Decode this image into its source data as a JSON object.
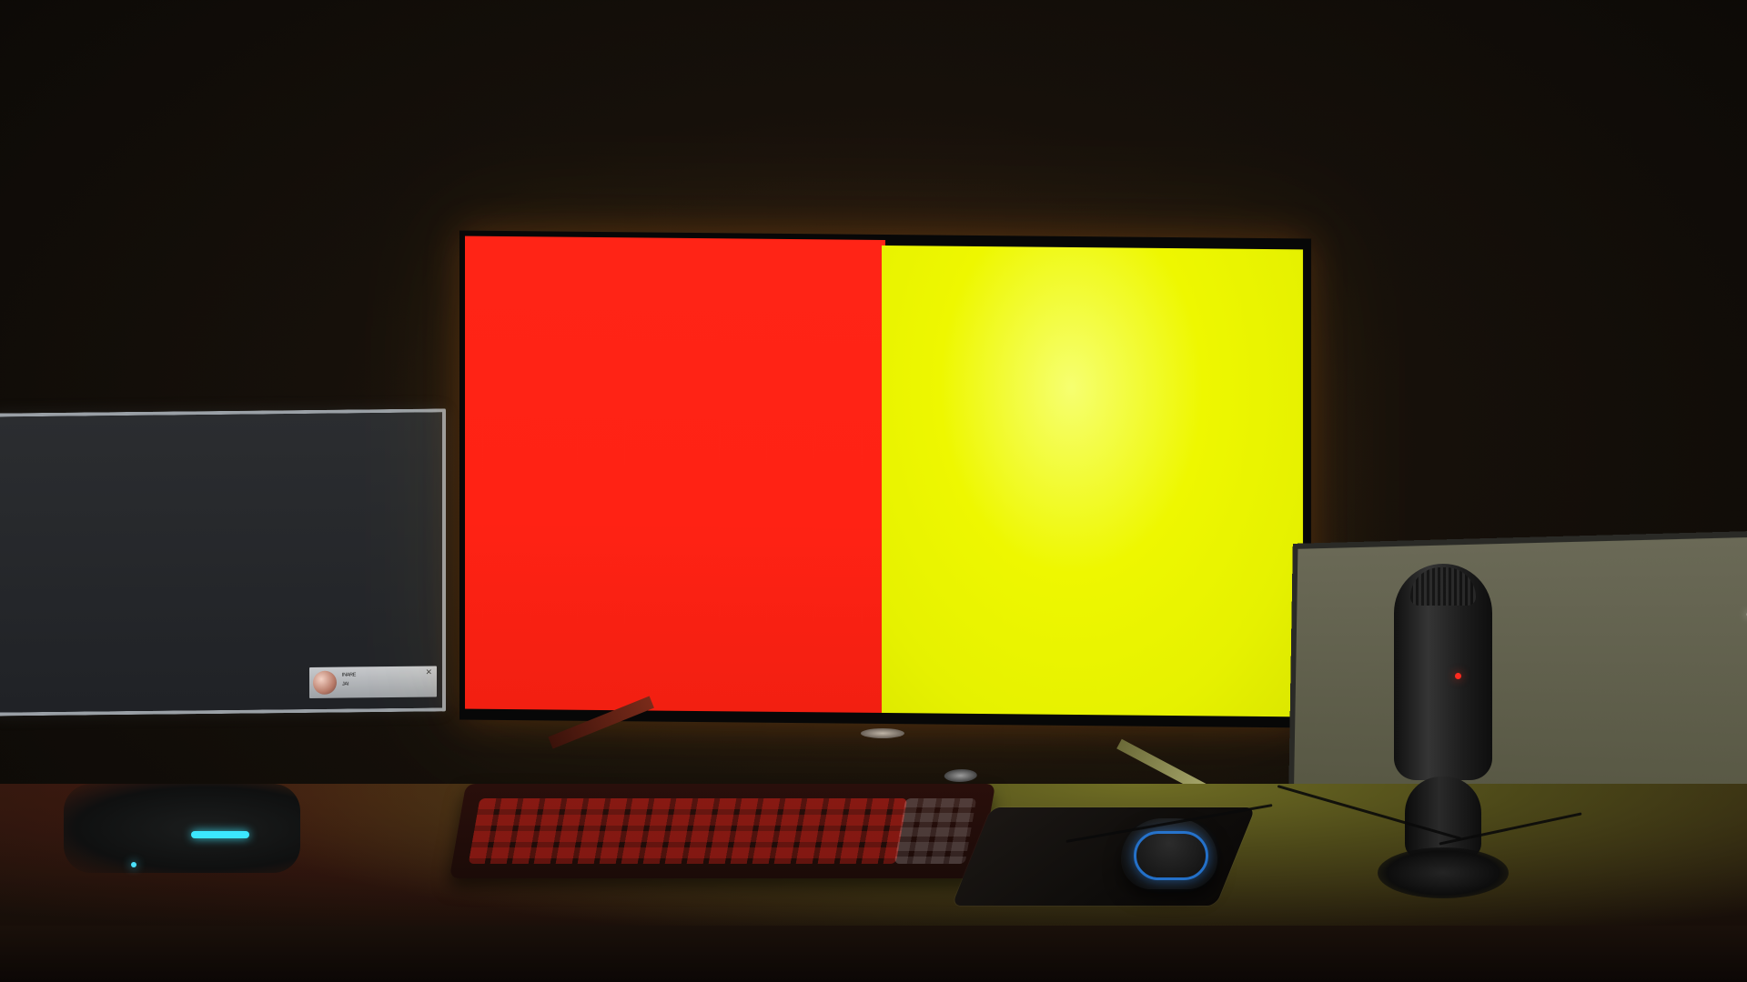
{
  "scene": {
    "colors": {
      "main_left_panel": "#ff2416",
      "main_right_panel": "#eef700",
      "background": "#0b0906",
      "accent_blue": "#288cff",
      "accent_cyan": "#3ce7ff",
      "mic_led": "#ff2a1f"
    }
  },
  "left_monitor": {
    "toast": {
      "title": "ᴵᴺᴬᴿᴱ",
      "subtitle": "ᴶᴬᴵ",
      "close": "×"
    }
  }
}
